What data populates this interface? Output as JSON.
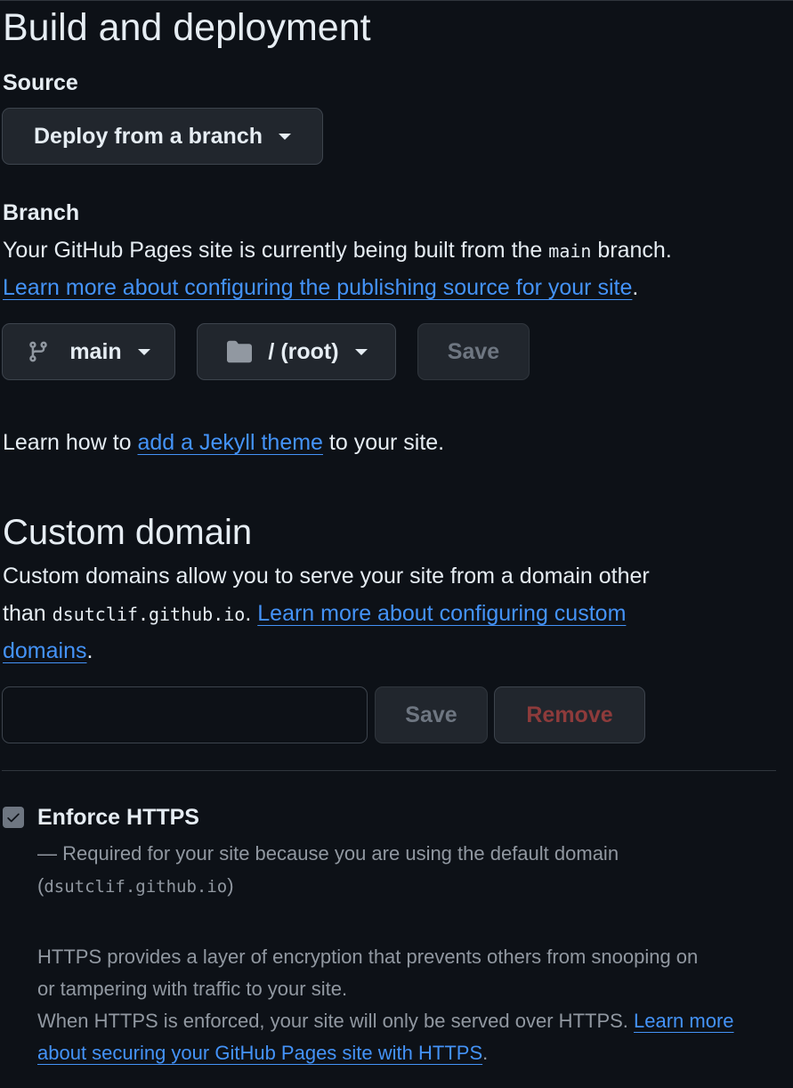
{
  "build": {
    "heading": "Build and deployment",
    "source_label": "Source",
    "source_value": "Deploy from a branch",
    "branch_label": "Branch",
    "branch_text_before": "Your GitHub Pages site is currently being built from the ",
    "branch_code": "main",
    "branch_text_after": " branch.",
    "learn_link": "Learn more about configuring the publishing source for your site",
    "learn_link_suffix": ".",
    "branch_select": "main",
    "folder_select": "/ (root)",
    "save_label": "Save",
    "jekyll_before": "Learn how to ",
    "jekyll_link": "add a Jekyll theme",
    "jekyll_after": " to your site."
  },
  "custom_domain": {
    "heading": "Custom domain",
    "desc_line1": "Custom domains allow you to serve your site from a domain other",
    "desc_than": "than ",
    "desc_code": "dsutclif.github.io",
    "desc_dot": ". ",
    "learn_link_part1": "Learn more about configuring custom",
    "learn_link_part2": "domains",
    "learn_link_suffix": ".",
    "input_value": "",
    "input_placeholder": "",
    "save_label": "Save",
    "remove_label": "Remove"
  },
  "https": {
    "checkbox_checked": true,
    "label": "Enforce HTTPS",
    "required_text": "— Required for your site because you are using the default domain",
    "required_open": "(",
    "required_code": "dsutclif.github.io",
    "required_close": ")",
    "desc_line1": "HTTPS provides a layer of encryption that prevents others from snooping on",
    "desc_line2": "or tampering with traffic to your site.",
    "desc_line3": "When HTTPS is enforced, your site will only be served over HTTPS. ",
    "learn_link_part1": "Learn more",
    "learn_link_part2": "about securing your GitHub Pages site with HTTPS",
    "learn_link_suffix": "."
  },
  "colors": {
    "background": "#0d1117",
    "text": "#e6edf3",
    "link": "#4493f8",
    "muted": "#9198a1",
    "button_bg": "#21262d",
    "border": "#3d444d"
  },
  "icons": {
    "source_caret": "caret-down-icon",
    "branch_icon": "git-branch-icon",
    "folder_icon": "folder-icon",
    "checkbox": "check-icon"
  }
}
